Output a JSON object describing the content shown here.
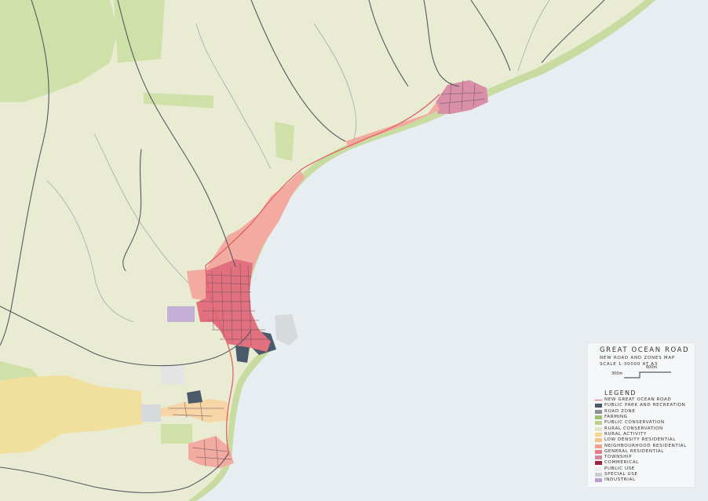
{
  "map": {
    "colors": {
      "ocean": "#e8edf2",
      "coast_band": "#c8dba0",
      "rural_conservation": "#e9ebd2",
      "public_conservation": "#cfe0a8",
      "farming": "#f1df9e",
      "road": "#555a60",
      "new_road": "#e06464",
      "township": "#d98fa8",
      "general_residential": "#e2707f",
      "neighbourhood_residential": "#f3aaa0",
      "public_park": "#4a5a6a",
      "special_use": "#d7dadd",
      "industrial": "#c4b0d6",
      "low_density": "#f6d6a6",
      "public_use": "#e4e4e4"
    }
  },
  "legend": {
    "title": "GREAT OCEAN ROAD",
    "subtitle": "NEW ROAD AND ZONES MAP",
    "scale_text": "SCALE 1:30000 AT A3",
    "scale_bar_a": "300m",
    "scale_bar_b": "600m",
    "heading": "LEGEND",
    "items": [
      {
        "label": "NEW GREAT OCEAN ROAD",
        "color": "#e06464",
        "kind": "line"
      },
      {
        "label": "PUBLIC PARK AND RECREATION",
        "color": "#4a5a6a",
        "kind": "fill"
      },
      {
        "label": "ROAD ZONE",
        "color": "#8b9096",
        "kind": "fill"
      },
      {
        "label": "FARMING",
        "color": "#9fbf73",
        "kind": "fill"
      },
      {
        "label": "PUBLIC CONSERVATION",
        "color": "#bcd08f",
        "kind": "fill"
      },
      {
        "label": "RURAL CONSERVATION",
        "color": "#e3e6c2",
        "kind": "fill"
      },
      {
        "label": "RURAL ACTIVITY",
        "color": "#f0d98c",
        "kind": "fill"
      },
      {
        "label": "LOW DENSITY RESIDENTIAL",
        "color": "#f2c489",
        "kind": "fill"
      },
      {
        "label": "NEIGHBOURHOOD RESIDENTIAL",
        "color": "#f0a08c",
        "kind": "fill"
      },
      {
        "label": "GENERAL RESIDENTIAL",
        "color": "#e57a86",
        "kind": "fill"
      },
      {
        "label": "TOWNSHIP",
        "color": "#d4869e",
        "kind": "fill"
      },
      {
        "label": "COMMERICAL",
        "color": "#9c2442",
        "kind": "fill"
      },
      {
        "label": "PUBLIC USE",
        "color": "#ececec",
        "kind": "fill"
      },
      {
        "label": "SPECIAL USE",
        "color": "#c9ccd0",
        "kind": "fill"
      },
      {
        "label": "INDUSTRIAL",
        "color": "#b9a0cf",
        "kind": "fill"
      }
    ]
  }
}
